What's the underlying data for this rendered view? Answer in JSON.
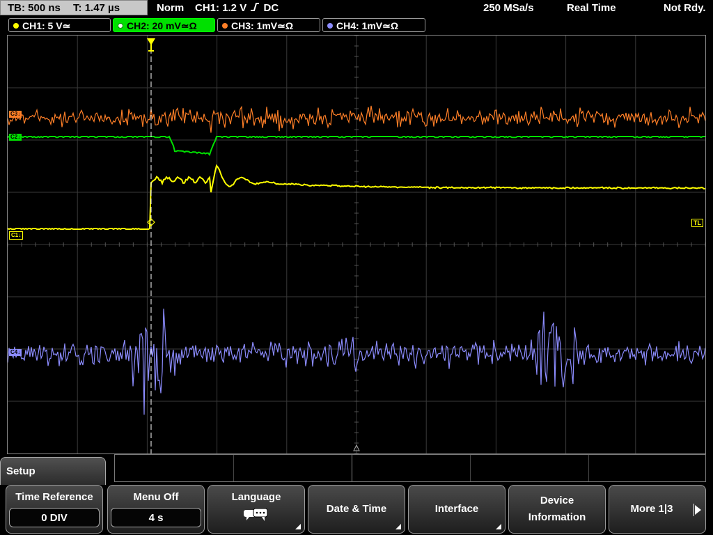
{
  "status": {
    "timebase": "TB: 500 ns",
    "trigger_time": "T: 1.47 µs",
    "trigger_mode": "Norm",
    "trigger_info": "CH1: 1.2 V",
    "trigger_coupling": "DC",
    "sample_rate": "250 MSa/s",
    "acq_mode": "Real Time",
    "acq_state": "Not Rdy."
  },
  "channels": [
    {
      "label": "CH1: 5 V≃",
      "color": "#ffff00"
    },
    {
      "label": "CH2: 20 mV≃Ω",
      "color": "#00e000"
    },
    {
      "label": "CH3: 1mV≃Ω",
      "color": "#ff7f27"
    },
    {
      "label": "CH4: 1mV≃Ω",
      "color": "#8c8cff"
    }
  ],
  "markers": {
    "ch3": "C3↓",
    "ch2": "C2↓",
    "ch1": "C1↓",
    "ch4": "C4↓",
    "trigger_level": "TL"
  },
  "menu": {
    "title": "Setup",
    "keys": [
      {
        "label": "Time Reference",
        "value": "0 DIV"
      },
      {
        "label": "Menu Off",
        "value": "4 s"
      },
      {
        "label": "Language",
        "icon": "speech-bubbles-icon"
      },
      {
        "label": "Date & Time"
      },
      {
        "label": "Interface"
      },
      {
        "label_line1": "Device",
        "label_line2": "Information"
      },
      {
        "label": "More 1|3"
      }
    ]
  }
}
